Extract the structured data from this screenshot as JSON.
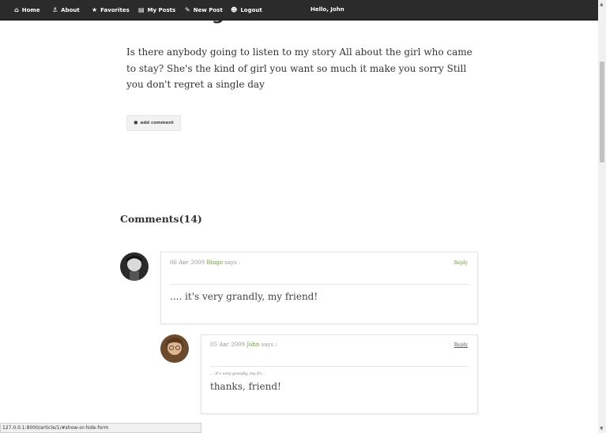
{
  "nav": {
    "items": [
      {
        "label": "Home",
        "icon": "home-icon"
      },
      {
        "label": "About",
        "icon": "anchor-icon"
      },
      {
        "label": "Favorites",
        "icon": "star-icon"
      },
      {
        "label": "My Posts",
        "icon": "book-icon"
      },
      {
        "label": "New Post",
        "icon": "pencil-square-icon"
      },
      {
        "label": "Logout",
        "icon": "user-lock-icon"
      }
    ],
    "greeting": "Hello,  John"
  },
  "post": {
    "title": "New Song Theme",
    "body": "Is there anybody going to listen to my story All about the girl who came to stay? She's the kind of girl you want so much it make you sorry Still you don't regret a single day",
    "add_comment_label": "add comment"
  },
  "comments": {
    "heading": "Comments(14)",
    "items": [
      {
        "date": "06 Авг 2009",
        "author": "Ringo",
        "says": "says :",
        "reply": "Reply",
        "text": ".... it's very grandly, my friend!"
      },
      {
        "date": "05 Авг 2009",
        "author": "John",
        "says": "says :",
        "reply": "Reply",
        "quote": "... it's very grandly, my fri...",
        "text": "thanks, friend!"
      }
    ]
  },
  "status_url": "127.0.0.1:8000/article/1/#show-or-hide-form",
  "colors": {
    "nav_bg": "#2b2b2b",
    "accent": "#6a9b2f"
  }
}
